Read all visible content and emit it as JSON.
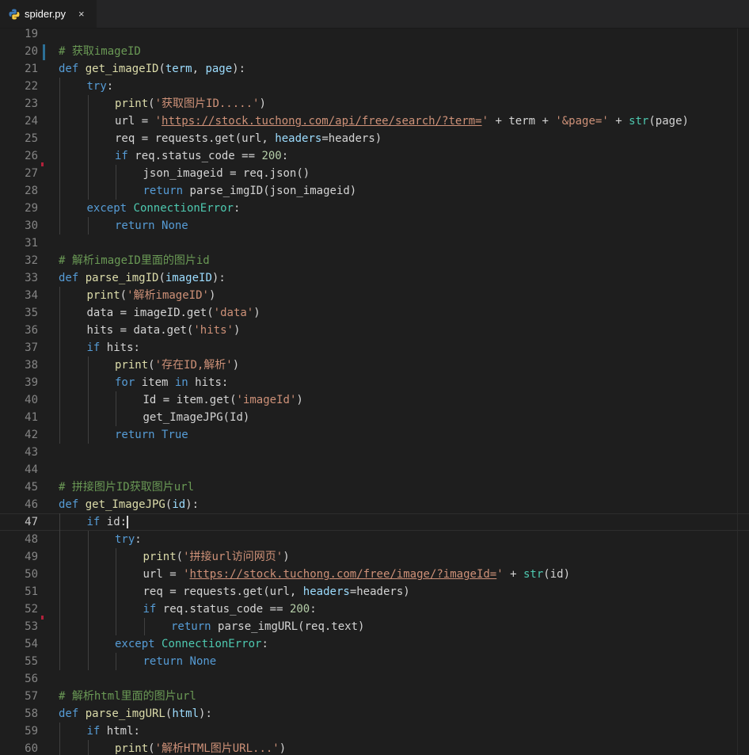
{
  "tab": {
    "filename": "spider.py",
    "icon": "python-icon",
    "close_glyph": "×"
  },
  "current_line": 47,
  "modified_lines": [
    20
  ],
  "error_ticks": [
    26,
    52
  ],
  "lines": [
    {
      "n": 19,
      "indent": 0,
      "tokens": []
    },
    {
      "n": 20,
      "indent": 0,
      "tokens": [
        [
          "c",
          "# 获取imageID"
        ]
      ]
    },
    {
      "n": 21,
      "indent": 0,
      "tokens": [
        [
          "k",
          "def "
        ],
        [
          "f",
          "get_imageID"
        ],
        [
          "x",
          "("
        ],
        [
          "p",
          "term"
        ],
        [
          "x",
          ", "
        ],
        [
          "p",
          "page"
        ],
        [
          "x",
          "):"
        ]
      ]
    },
    {
      "n": 22,
      "indent": 1,
      "tokens": [
        [
          "k",
          "try"
        ],
        [
          "x",
          ":"
        ]
      ]
    },
    {
      "n": 23,
      "indent": 2,
      "tokens": [
        [
          "f",
          "print"
        ],
        [
          "x",
          "("
        ],
        [
          "s",
          "'获取图片ID.....'"
        ],
        [
          "x",
          ")"
        ]
      ]
    },
    {
      "n": 24,
      "indent": 2,
      "tokens": [
        [
          "x",
          "url = "
        ],
        [
          "s",
          "'"
        ],
        [
          "u",
          "https://stock.tuchong.com/api/free/search/?term="
        ],
        [
          "s",
          "'"
        ],
        [
          "x",
          " + term + "
        ],
        [
          "s",
          "'&page='"
        ],
        [
          "x",
          " + "
        ],
        [
          "t",
          "str"
        ],
        [
          "x",
          "(page)"
        ]
      ]
    },
    {
      "n": 25,
      "indent": 2,
      "tokens": [
        [
          "x",
          "req = requests.get(url, "
        ],
        [
          "p",
          "headers"
        ],
        [
          "x",
          "=headers)"
        ]
      ]
    },
    {
      "n": 26,
      "indent": 2,
      "tokens": [
        [
          "k",
          "if "
        ],
        [
          "x",
          "req.status_code == "
        ],
        [
          "n",
          "200"
        ],
        [
          "x",
          ":"
        ]
      ]
    },
    {
      "n": 27,
      "indent": 3,
      "tokens": [
        [
          "x",
          "json_imageid = req.json()"
        ]
      ]
    },
    {
      "n": 28,
      "indent": 3,
      "tokens": [
        [
          "k",
          "return "
        ],
        [
          "x",
          "parse_imgID(json_imageid)"
        ]
      ]
    },
    {
      "n": 29,
      "indent": 1,
      "tokens": [
        [
          "k",
          "except "
        ],
        [
          "t",
          "ConnectionError"
        ],
        [
          "x",
          ":"
        ]
      ]
    },
    {
      "n": 30,
      "indent": 2,
      "tokens": [
        [
          "k",
          "return "
        ],
        [
          "k",
          "None"
        ]
      ]
    },
    {
      "n": 31,
      "indent": 0,
      "tokens": []
    },
    {
      "n": 32,
      "indent": 0,
      "tokens": [
        [
          "c",
          "# 解析imageID里面的图片id"
        ]
      ]
    },
    {
      "n": 33,
      "indent": 0,
      "tokens": [
        [
          "k",
          "def "
        ],
        [
          "f",
          "parse_imgID"
        ],
        [
          "x",
          "("
        ],
        [
          "p",
          "imageID"
        ],
        [
          "x",
          "):"
        ]
      ]
    },
    {
      "n": 34,
      "indent": 1,
      "tokens": [
        [
          "f",
          "print"
        ],
        [
          "x",
          "("
        ],
        [
          "s",
          "'解析imageID'"
        ],
        [
          "x",
          ")"
        ]
      ]
    },
    {
      "n": 35,
      "indent": 1,
      "tokens": [
        [
          "x",
          "data = imageID.get("
        ],
        [
          "s",
          "'data'"
        ],
        [
          "x",
          ")"
        ]
      ]
    },
    {
      "n": 36,
      "indent": 1,
      "tokens": [
        [
          "x",
          "hits = data.get("
        ],
        [
          "s",
          "'hits'"
        ],
        [
          "x",
          ")"
        ]
      ]
    },
    {
      "n": 37,
      "indent": 1,
      "tokens": [
        [
          "k",
          "if "
        ],
        [
          "x",
          "hits:"
        ]
      ]
    },
    {
      "n": 38,
      "indent": 2,
      "tokens": [
        [
          "f",
          "print"
        ],
        [
          "x",
          "("
        ],
        [
          "s",
          "'存在ID,解析'"
        ],
        [
          "x",
          ")"
        ]
      ]
    },
    {
      "n": 39,
      "indent": 2,
      "tokens": [
        [
          "k",
          "for "
        ],
        [
          "x",
          "item "
        ],
        [
          "k",
          "in "
        ],
        [
          "x",
          "hits:"
        ]
      ]
    },
    {
      "n": 40,
      "indent": 3,
      "tokens": [
        [
          "x",
          "Id = item.get("
        ],
        [
          "s",
          "'imageId'"
        ],
        [
          "x",
          ")"
        ]
      ]
    },
    {
      "n": 41,
      "indent": 3,
      "tokens": [
        [
          "x",
          "get_ImageJPG(Id)"
        ]
      ]
    },
    {
      "n": 42,
      "indent": 2,
      "tokens": [
        [
          "k",
          "return "
        ],
        [
          "k",
          "True"
        ]
      ]
    },
    {
      "n": 43,
      "indent": 0,
      "tokens": []
    },
    {
      "n": 44,
      "indent": 0,
      "tokens": []
    },
    {
      "n": 45,
      "indent": 0,
      "tokens": [
        [
          "c",
          "# 拼接图片ID获取图片url"
        ]
      ]
    },
    {
      "n": 46,
      "indent": 0,
      "tokens": [
        [
          "k",
          "def "
        ],
        [
          "f",
          "get_ImageJPG"
        ],
        [
          "x",
          "("
        ],
        [
          "p",
          "id"
        ],
        [
          "x",
          "):"
        ]
      ]
    },
    {
      "n": 47,
      "indent": 1,
      "tokens": [
        [
          "k",
          "if "
        ],
        [
          "x",
          "id:"
        ]
      ]
    },
    {
      "n": 48,
      "indent": 2,
      "tokens": [
        [
          "k",
          "try"
        ],
        [
          "x",
          ":"
        ]
      ]
    },
    {
      "n": 49,
      "indent": 3,
      "tokens": [
        [
          "f",
          "print"
        ],
        [
          "x",
          "("
        ],
        [
          "s",
          "'拼接url访问网页'"
        ],
        [
          "x",
          ")"
        ]
      ]
    },
    {
      "n": 50,
      "indent": 3,
      "tokens": [
        [
          "x",
          "url = "
        ],
        [
          "s",
          "'"
        ],
        [
          "u",
          "https://stock.tuchong.com/free/image/?imageId="
        ],
        [
          "s",
          "'"
        ],
        [
          "x",
          " + "
        ],
        [
          "t",
          "str"
        ],
        [
          "x",
          "(id)"
        ]
      ]
    },
    {
      "n": 51,
      "indent": 3,
      "tokens": [
        [
          "x",
          "req = requests.get(url, "
        ],
        [
          "p",
          "headers"
        ],
        [
          "x",
          "=headers)"
        ]
      ]
    },
    {
      "n": 52,
      "indent": 3,
      "tokens": [
        [
          "k",
          "if "
        ],
        [
          "x",
          "req.status_code == "
        ],
        [
          "n",
          "200"
        ],
        [
          "x",
          ":"
        ]
      ]
    },
    {
      "n": 53,
      "indent": 4,
      "tokens": [
        [
          "k",
          "return "
        ],
        [
          "x",
          "parse_imgURL(req.text)"
        ]
      ]
    },
    {
      "n": 54,
      "indent": 2,
      "tokens": [
        [
          "k",
          "except "
        ],
        [
          "t",
          "ConnectionError"
        ],
        [
          "x",
          ":"
        ]
      ]
    },
    {
      "n": 55,
      "indent": 3,
      "tokens": [
        [
          "k",
          "return "
        ],
        [
          "k",
          "None"
        ]
      ]
    },
    {
      "n": 56,
      "indent": 0,
      "tokens": []
    },
    {
      "n": 57,
      "indent": 0,
      "tokens": [
        [
          "c",
          "# 解析html里面的图片url"
        ]
      ]
    },
    {
      "n": 58,
      "indent": 0,
      "tokens": [
        [
          "k",
          "def "
        ],
        [
          "f",
          "parse_imgURL"
        ],
        [
          "x",
          "("
        ],
        [
          "p",
          "html"
        ],
        [
          "x",
          "):"
        ]
      ]
    },
    {
      "n": 59,
      "indent": 1,
      "tokens": [
        [
          "k",
          "if "
        ],
        [
          "x",
          "html:"
        ]
      ]
    },
    {
      "n": 60,
      "indent": 2,
      "tokens": [
        [
          "f",
          "print"
        ],
        [
          "x",
          "("
        ],
        [
          "s",
          "'解析HTML图片URL...'"
        ],
        [
          "x",
          ")"
        ]
      ]
    }
  ]
}
